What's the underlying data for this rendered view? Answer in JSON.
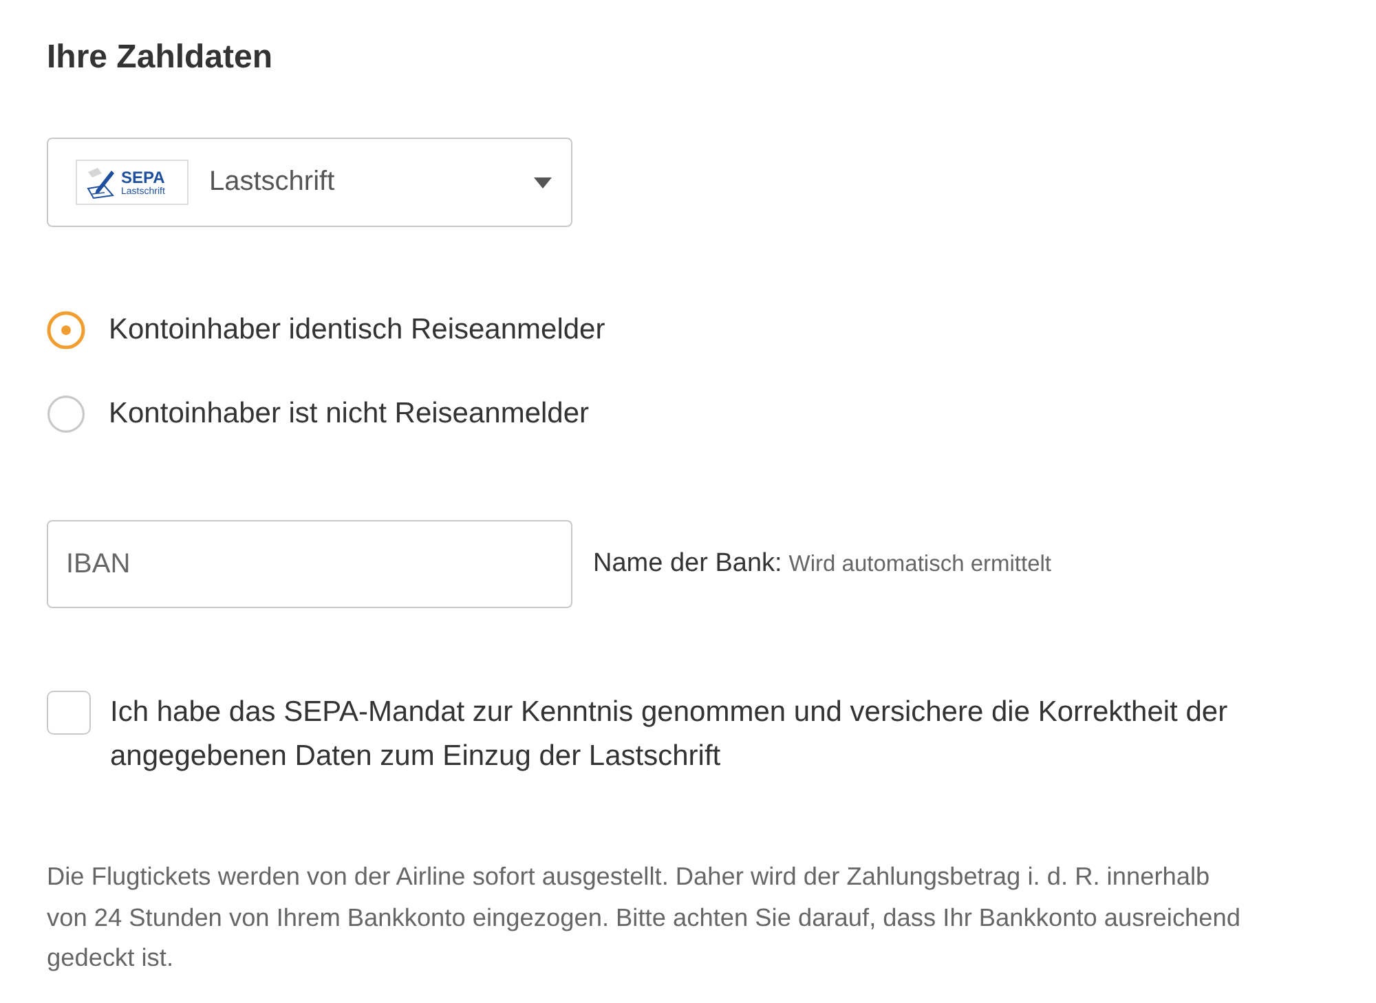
{
  "heading": "Ihre Zahldaten",
  "payment_method": {
    "logo": {
      "title": "SEPA",
      "subtitle": "Lastschrift"
    },
    "value": "Lastschrift"
  },
  "account_holder_options": [
    {
      "label": "Kontoinhaber identisch Reiseanmelder",
      "selected": true
    },
    {
      "label": "Kontoinhaber ist nicht Reiseanmelder",
      "selected": false
    }
  ],
  "iban": {
    "placeholder": "IBAN"
  },
  "bank_name": {
    "label": "Name der Bank:",
    "value": "Wird automatisch ermittelt"
  },
  "mandate": {
    "label": "Ich habe das SEPA-Mandat zur Kenntnis genommen und versichere die Korrektheit der angegebenen Daten zum Einzug der Lastschrift",
    "checked": false
  },
  "notice": "Die Flugtickets werden von der Airline sofort ausgestellt. Daher wird der Zahlungsbetrag i. d. R. innerhalb von 24 Stunden von Ihrem Bankkonto eingezogen. Bitte achten Sie darauf, dass Ihr Bankkonto ausreichend gedeckt ist."
}
